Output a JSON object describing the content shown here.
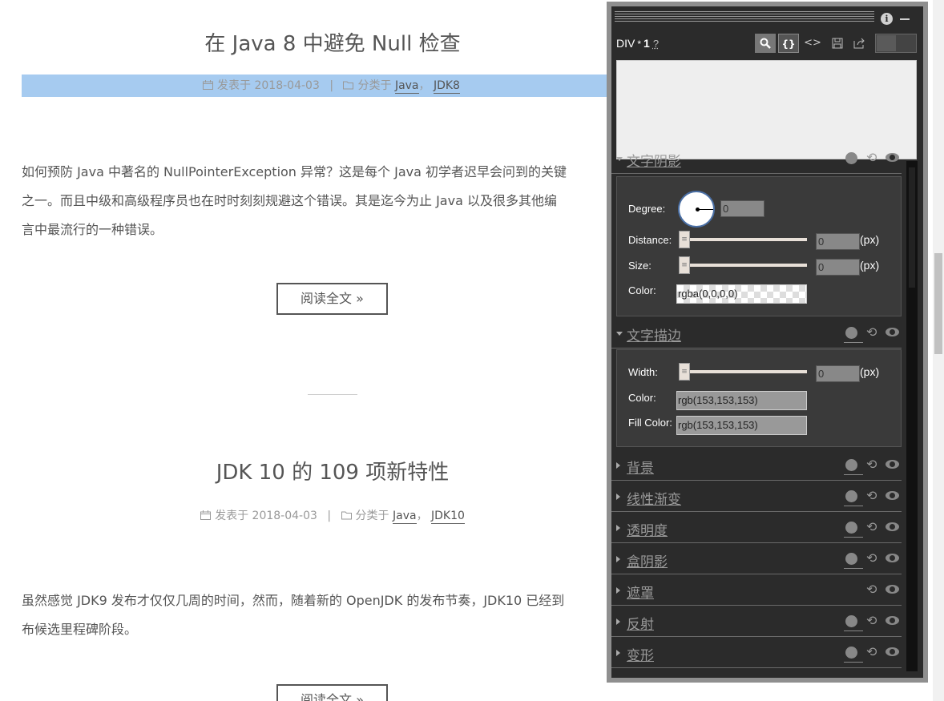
{
  "posts": [
    {
      "title": "在 Java 8 中避免 Null 检查",
      "posted_label": "发表于",
      "date": "2018-04-03",
      "category_label": "分类于",
      "categories": [
        "Java",
        "JDK8"
      ],
      "excerpt_lines": [
        "如何预防 Java 中著名的 NullPointerException 异常？这是每个 Java 初学者迟早会问到的关键",
        "之一。而且中级和高级程序员也在时时刻刻规避这个错误。其是迄今为止 Java 以及很多其他编",
        "言中最流行的一种错误。"
      ],
      "read_more": "阅读全文 »"
    },
    {
      "title": "JDK 10 的 109 项新特性",
      "posted_label": "发表于",
      "date": "2018-04-03",
      "category_label": "分类于",
      "categories": [
        "Java",
        "JDK10"
      ],
      "excerpt_lines": [
        "虽然感觉 JDK9 发布才仅仅几周的时间，然而，随着新的 OpenJDK 的发布节奏，JDK10 已经到",
        "布候选里程碑阶段。"
      ],
      "read_more": "阅读全文 »"
    }
  ],
  "meta_separator": "|",
  "category_separator": "，",
  "editor": {
    "selector": "DIV",
    "star": "*",
    "count": "1",
    "help": "?",
    "info_icon": "i",
    "toolbar": {
      "search_icon": "search-icon",
      "braces_label": "{}",
      "code_label": "<>",
      "save_icon": "save-icon",
      "export_icon": "export-icon"
    },
    "text_shadow": {
      "label": "文字阴影",
      "degree_label": "Degree:",
      "degree_value": "0",
      "distance_label": "Distance:",
      "distance_value": "0",
      "size_label": "Size:",
      "size_value": "0",
      "unit": "(px)",
      "color_label": "Color:",
      "color_value": "rgba(0,0,0,0)"
    },
    "text_stroke": {
      "label": "文字描边",
      "width_label": "Width:",
      "width_value": "0",
      "unit": "(px)",
      "color_label": "Color:",
      "color_value": "rgb(153,153,153)",
      "fill_label": "Fill Color:",
      "fill_value": "rgb(153,153,153)"
    },
    "collapsed_sections": [
      "背景",
      "线性渐变",
      "透明度",
      "盒阴影",
      "遮罩",
      "反射",
      "变形"
    ],
    "reset_glyph": "⟲",
    "slider_glyph": "≡"
  }
}
